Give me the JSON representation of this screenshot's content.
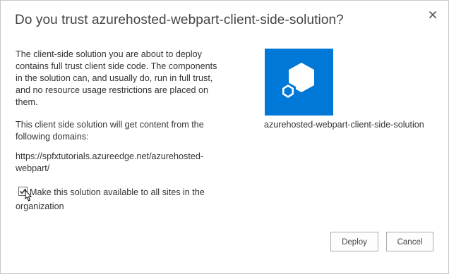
{
  "dialog": {
    "title": "Do you trust azurehosted-webpart-client-side-solution?",
    "close_icon": "close-icon",
    "intro_text": "The client-side solution you are about to deploy contains full trust client side code. The components in the solution can, and usually do, run in full trust, and no resource usage restrictions are placed on them.",
    "domains_text": "This client side solution will get content from the following domains:",
    "domain_url": "https://spfxtutorials.azureedge.net/azurehosted-webpart/",
    "checkbox": {
      "label": "Make this solution available to all sites in the organization",
      "checked": true
    },
    "app": {
      "icon": "office-app-icon",
      "name": "azurehosted-webpart-client-side-solution",
      "tile_color": "#0078d7"
    },
    "buttons": {
      "deploy_label": "Deploy",
      "cancel_label": "Cancel"
    }
  }
}
